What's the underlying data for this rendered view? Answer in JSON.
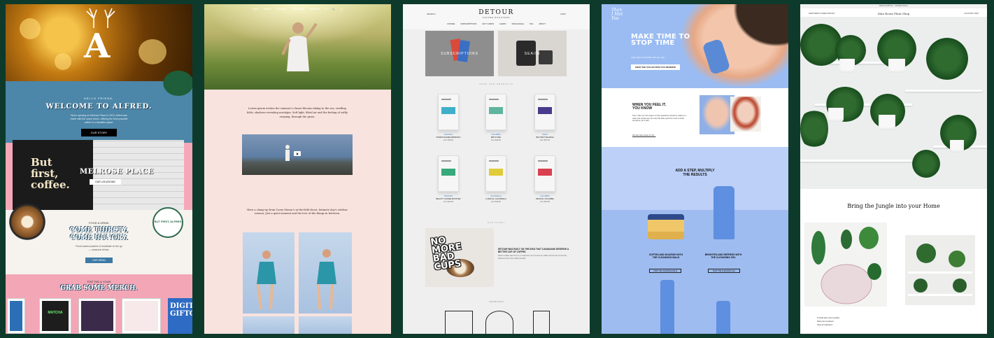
{
  "panel1": {
    "hero_logo": "A",
    "welcome": {
      "kicker": "HELLO FRIEND,",
      "title": "WELCOME TO ALFRED.",
      "body": "Since opening on Melrose Place in 2013, Alfred was made with the same vision: offering the best possible coffee in a beautiful space.",
      "button": "OUR STORY"
    },
    "melrose": {
      "sign_line1": "But",
      "sign_line2": "first,",
      "sign_line3": "coffee.",
      "title": "MELROSE PLACE",
      "button": "OUR LOCATIONS"
    },
    "food": {
      "kicker": "FOOD & DRINK",
      "title_line1": "COME THIRSTY,",
      "title_line2": "COME HUNGRY.",
      "body": "Fresh-baked pastries & breakfast on the go — seasonal drinks.",
      "button": "OUR MENU",
      "badge": "BUT FIRST, ALFRED"
    },
    "merch": {
      "kicker": "FOR THE & YOUR",
      "title": "GRAB SOME MERCH.",
      "card2_text": "MATCHA",
      "giftcard_line1": "DIGITA",
      "giftcard_line2": "GIFTC"
    }
  },
  "panel2": {
    "nav": [
      "SHOP",
      "ABOUT",
      "JOURNAL",
      "STOCKISTS",
      "CONTACT",
      "♥",
      "🔍",
      "◯"
    ],
    "text1": "Lorem ipsum evokes the summer's classic blooms taking to the sea, swelling folds, shadows revealing nostalgia. Soft light, lifted air and the feeling of softly swaying, through the grass.",
    "text2": "Here a clamp-up from Corey Mason's in-the-field shoot, Intimate day's outdoor session. Just a quiet moment and the love of the things in between."
  },
  "panel3": {
    "logo": "DETOUR",
    "logo_sub": "COFFEE ROASTERS",
    "search": "SEARCH",
    "account": "CART",
    "nav": [
      "COFFEE",
      "SUBSCRIPTIONS",
      "GIFT CARDS",
      "LEARN",
      "WHOLESALE",
      "TEA",
      "ABOUT"
    ],
    "tile_sub": "SUBSCRIPTIONS",
    "tile_sea": "SEA/IN",
    "section_products": "SHOP OUR PRODUCTS",
    "products": [
      {
        "origin": "ETHIOPIA",
        "name": "PUMKIN SHARE ESPRESSO",
        "price": "from $18.00",
        "color": "#3fb0c9"
      },
      {
        "origin": "COLOMBIA",
        "name": "BIRTH ONE",
        "price": "from $18.00",
        "color": "#5fb59d"
      },
      {
        "origin": "PERU",
        "name": "BEYOND THE EDGE",
        "price": "from $21.00",
        "color": "#4a3a8c"
      },
      {
        "origin": "ETHIOPIA",
        "name": "BEAUTY COFFEE BOOSTER",
        "price": "from $19.00",
        "color": "#37a97a"
      },
      {
        "origin": "GUATEMALA",
        "name": "LA BOLSA, GUATEMALA",
        "price": "from $19.00",
        "color": "#e2cb3a"
      },
      {
        "origin": "COLOMBIA",
        "name": "DETOUR, COLOMBIA",
        "price": "from $20.00",
        "color": "#d8414f"
      }
    ],
    "section_story": "OUR STORY",
    "cups_line1": "NO",
    "cups_line2": "MORE",
    "cups_line3": "BAD",
    "cups_line4": "CUPS",
    "story_heading": "DETOUR WAS BUILT ON THE IDEA THAT CANADIANS DESERVE A BETTER CUP OF COFFEE.",
    "story_body": "Detour Coffee was born in a small town out of a love for coffee and its rich community. Flavours that move coffee forward.",
    "how": "HOW WE ROAST"
  },
  "panel4": {
    "brand_line1": "Then",
    "brand_line2": "I Met",
    "brand_line3": "You",
    "headline": "MAKE TIME TO STOP TIME",
    "sub": "Light, tight and flexible self-care day.",
    "button": "SHOP THE COLLECTION YOU DESERVE",
    "feel": {
      "heading_line1": "WHEN YOU FEEL IT,",
      "heading_line2": "YOU KNOW",
      "body": "Then I Met You The reason is that ingredients should be visible in a clean and simple way, the way that feels good from start to finish and gives you a plan.",
      "link": "We also have plenty on the..."
    },
    "step_line1": "ADD A STEP, MULTIPLY",
    "step_line2": "THE RESULTS",
    "prod1_line1": "SOFTEN AND NOURISH WITH",
    "prod1_line2": "THE CLEANSING BALM",
    "prod1_btn": "SHOP THE CLEANSING BALM",
    "prod2_line1": "BRIGHTEN AND REFRESH WITH",
    "prod2_line2": "THE CLEANSING GEL",
    "prod2_btn": "SHOP THE CLEANSING GEL"
  },
  "panel5": {
    "topbar": "FREE SHIPPING · ORDERS $100+",
    "nav_items": "SHOP   ABOUT   CARE   CONTACT",
    "logo": "Mini Room Plant Shop",
    "nav_right": "ACCOUNT   CART",
    "headline": "Bring the Jungle into your Home",
    "tiny_line1": "Tropical plant care & guides",
    "tiny_line2": "Plant pots & planters",
    "tiny_line3": "Shop all collections"
  }
}
